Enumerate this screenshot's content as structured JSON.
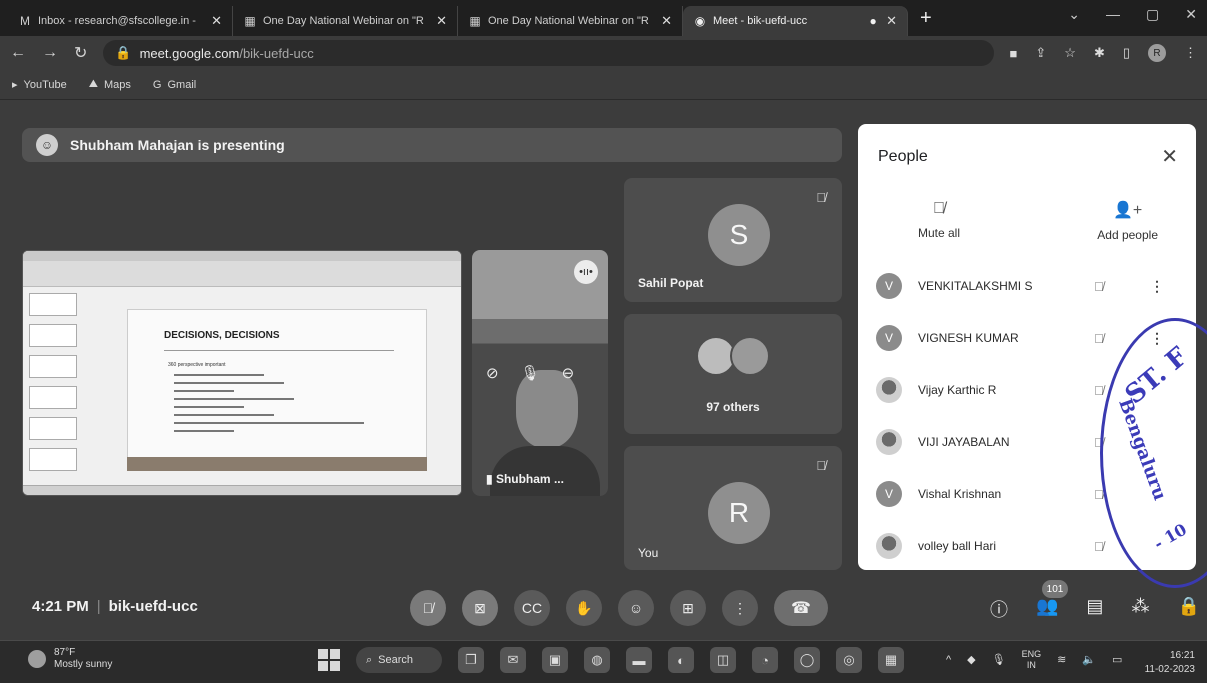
{
  "browser": {
    "tabs": [
      {
        "label": "Inbox - research@sfscollege.in - ",
        "icon": "gmail-icon",
        "active": false
      },
      {
        "label": "One Day National Webinar on \"R",
        "icon": "sheets-icon",
        "active": false
      },
      {
        "label": "One Day National Webinar on \"R",
        "icon": "sheets-icon",
        "active": false
      },
      {
        "label": "Meet - bik-uefd-ucc",
        "icon": "meet-icon",
        "active": true
      }
    ],
    "new_tab": "+",
    "url_host": "meet.google.com",
    "url_path": "/bik-uefd-ucc",
    "profile_initial": "R",
    "bookmarks": [
      "YouTube",
      "Maps",
      "Gmail"
    ]
  },
  "meet": {
    "presenting_text": "Shubham Mahajan is presenting",
    "slide": {
      "title": "DECISIONS, DECISIONS",
      "bullet": "360 perspective important"
    },
    "tiles": {
      "presenter_name": "Shubham ...",
      "sahil": {
        "initial": "S",
        "name": "Sahil Popat"
      },
      "others": {
        "label": "97 others"
      },
      "you": {
        "initial": "R",
        "name": "You"
      }
    },
    "time": "4:21 PM",
    "meeting_code": "bik-uefd-ucc",
    "participant_count": "101"
  },
  "people_panel": {
    "title": "People",
    "mute_all": "Mute all",
    "add_people": "Add people",
    "participants": [
      {
        "initial": "V",
        "name": "VENKITALAKSHMI S",
        "photo": false,
        "more": true
      },
      {
        "initial": "V",
        "name": "VIGNESH KUMAR",
        "photo": false,
        "more": true
      },
      {
        "initial": "",
        "name": "Vijay Karthic R",
        "photo": true,
        "more": false
      },
      {
        "initial": "",
        "name": "VIJI JAYABALAN",
        "photo": true,
        "more": false
      },
      {
        "initial": "V",
        "name": "Vishal Krishnan",
        "photo": false,
        "more": false
      },
      {
        "initial": "",
        "name": "volley ball Hari",
        "photo": true,
        "more": false
      }
    ]
  },
  "stamp": {
    "line1": "ST. F",
    "line2": "Bengaluru",
    "line3": "- 10"
  },
  "taskbar": {
    "temperature": "87°F",
    "weather": "Mostly sunny",
    "search_label": "Search",
    "lang_top": "ENG",
    "lang_bottom": "IN",
    "clock": "16:21",
    "date": "11-02-2023"
  },
  "colors": {
    "panel_bg": "#ffffff",
    "meet_bg": "#3c3c3c",
    "stamp_ink": "#3b3bb8"
  }
}
